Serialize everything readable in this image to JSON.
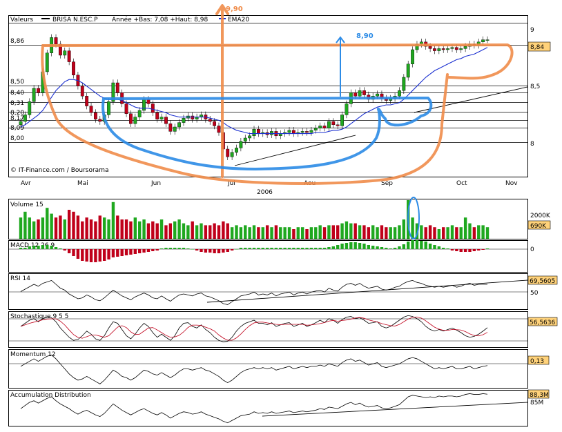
{
  "header": {
    "valeurs_label": "Valeurs",
    "ticker": "BRISA N.ESC.P",
    "range_text": "Année +Bas: 7,08 +Haut: 8,98",
    "ema_label": "EMA20",
    "source": "© IT-Finance.com / Boursorama",
    "year": "2006"
  },
  "annotations": {
    "orange_target": "9,90",
    "blue_target": "8,90"
  },
  "colors": {
    "up": "#1fa81f",
    "down": "#c0001a",
    "ema": "#1a2fd0",
    "orange": "#f08c4a",
    "blue": "#2c8be6",
    "value_box": "#ffd27a",
    "grid": "#000000"
  },
  "chart_data": [
    {
      "name": "price",
      "type": "candlestick",
      "x_months": [
        "Avr",
        "Mai",
        "Jun",
        "Jul",
        "Aou",
        "Sep",
        "Oct",
        "Nov"
      ],
      "y_ticks_right": [
        "9",
        "8,5",
        "8"
      ],
      "y_ticks_left": [
        "8,86",
        "8,50",
        "8,40",
        "8,31",
        "8,20",
        "8,17",
        "8,09",
        "8,00"
      ],
      "ylim": [
        7.6,
        9.05
      ],
      "last_value": "8,84",
      "close": [
        8.1,
        8.16,
        8.28,
        8.4,
        8.36,
        8.55,
        8.72,
        8.86,
        8.8,
        8.7,
        8.74,
        8.64,
        8.52,
        8.42,
        8.33,
        8.24,
        8.18,
        8.12,
        8.1,
        8.16,
        8.28,
        8.45,
        8.36,
        8.26,
        8.17,
        8.08,
        8.14,
        8.2,
        8.3,
        8.26,
        8.18,
        8.12,
        8.14,
        8.08,
        8.01,
        8.05,
        8.09,
        8.13,
        8.15,
        8.12,
        8.14,
        8.16,
        8.12,
        8.1,
        8.06,
        8.0,
        7.85,
        7.78,
        7.82,
        7.86,
        7.92,
        7.95,
        7.97,
        8.03,
        7.99,
        8.0,
        7.98,
        8.01,
        7.97,
        7.99,
        8.0,
        8.02,
        7.99,
        8.0,
        8.01,
        8.0,
        8.02,
        8.04,
        8.06,
        8.04,
        8.1,
        8.07,
        8.06,
        8.16,
        8.26,
        8.36,
        8.33,
        8.38,
        8.34,
        8.3,
        8.33,
        8.35,
        8.31,
        8.29,
        8.31,
        8.33,
        8.38,
        8.5,
        8.62,
        8.75,
        8.8,
        8.82,
        8.78,
        8.76,
        8.74,
        8.76,
        8.75,
        8.76,
        8.77,
        8.75,
        8.76,
        8.78,
        8.8,
        8.79,
        8.82,
        8.84,
        8.84
      ],
      "ema20": [
        8.05,
        8.07,
        8.1,
        8.13,
        8.16,
        8.2,
        8.26,
        8.32,
        8.38,
        8.42,
        8.46,
        8.48,
        8.48,
        8.47,
        8.45,
        8.42,
        8.39,
        8.36,
        8.33,
        8.31,
        8.3,
        8.3,
        8.3,
        8.29,
        8.27,
        8.25,
        8.23,
        8.22,
        8.22,
        8.22,
        8.21,
        8.2,
        8.19,
        8.18,
        8.16,
        8.15,
        8.14,
        8.14,
        8.14,
        8.14,
        8.14,
        8.14,
        8.14,
        8.13,
        8.12,
        8.11,
        8.09,
        8.06,
        8.04,
        8.02,
        8.01,
        8.0,
        7.99,
        7.99,
        7.99,
        7.99,
        7.99,
        7.99,
        7.99,
        7.99,
        7.99,
        7.99,
        7.99,
        7.99,
        7.99,
        7.99,
        7.99,
        8.0,
        8.0,
        8.0,
        8.01,
        8.02,
        8.02,
        8.03,
        8.05,
        8.08,
        8.11,
        8.14,
        8.17,
        8.19,
        8.21,
        8.23,
        8.24,
        8.25,
        8.25,
        8.26,
        8.27,
        8.3,
        8.34,
        8.38,
        8.42,
        8.46,
        8.5,
        8.53,
        8.56,
        8.58,
        8.6,
        8.62,
        8.64,
        8.66,
        8.67,
        8.69,
        8.7,
        8.71,
        8.73,
        8.75,
        8.77
      ]
    },
    {
      "name": "volume",
      "type": "bar",
      "label": "Volume 15",
      "y_ticks": [
        "2000K"
      ],
      "last_value": "690K",
      "values": [
        0.55,
        0.7,
        0.55,
        0.45,
        0.5,
        0.55,
        0.8,
        0.65,
        0.55,
        0.6,
        0.5,
        0.75,
        0.7,
        0.6,
        0.45,
        0.55,
        0.5,
        0.45,
        0.6,
        0.55,
        0.5,
        0.95,
        0.6,
        0.5,
        0.5,
        0.45,
        0.55,
        0.45,
        0.5,
        0.4,
        0.45,
        0.4,
        0.5,
        0.35,
        0.4,
        0.45,
        0.5,
        0.4,
        0.35,
        0.45,
        0.35,
        0.4,
        0.35,
        0.35,
        0.4,
        0.35,
        0.45,
        0.4,
        0.3,
        0.35,
        0.3,
        0.35,
        0.3,
        0.35,
        0.3,
        0.3,
        0.35,
        0.3,
        0.35,
        0.3,
        0.3,
        0.3,
        0.25,
        0.3,
        0.3,
        0.25,
        0.3,
        0.3,
        0.35,
        0.3,
        0.35,
        0.35,
        0.35,
        0.4,
        0.45,
        0.4,
        0.4,
        0.35,
        0.35,
        0.3,
        0.35,
        0.3,
        0.35,
        0.3,
        0.3,
        0.3,
        0.35,
        0.5,
        1.0,
        0.55,
        0.4,
        0.35,
        0.3,
        0.35,
        0.3,
        0.25,
        0.3,
        0.3,
        0.35,
        0.3,
        0.3,
        0.55,
        0.4,
        0.3,
        0.35,
        0.35,
        0.3
      ]
    },
    {
      "name": "macd",
      "type": "bar",
      "label": "MACD 12 26 9",
      "y_ticks": [
        "0"
      ],
      "values": [
        0.1,
        0.1,
        0.2,
        0.25,
        0.25,
        0.3,
        0.3,
        0.25,
        0.15,
        0.05,
        -0.1,
        -0.3,
        -0.5,
        -0.7,
        -0.85,
        -0.9,
        -0.95,
        -0.95,
        -0.9,
        -0.85,
        -0.75,
        -0.6,
        -0.55,
        -0.5,
        -0.45,
        -0.4,
        -0.35,
        -0.3,
        -0.25,
        -0.2,
        -0.15,
        -0.1,
        0.05,
        0.1,
        0.1,
        0.1,
        0.1,
        0.1,
        0.05,
        0.0,
        -0.1,
        -0.2,
        -0.25,
        -0.25,
        -0.3,
        -0.3,
        -0.25,
        -0.2,
        -0.1,
        0.0,
        0.1,
        0.1,
        0.1,
        0.1,
        0.1,
        0.1,
        0.1,
        0.1,
        0.1,
        0.1,
        0.1,
        0.1,
        0.1,
        0.1,
        0.1,
        0.1,
        0.1,
        0.1,
        0.1,
        0.1,
        0.15,
        0.2,
        0.3,
        0.4,
        0.45,
        0.5,
        0.5,
        0.45,
        0.4,
        0.3,
        0.25,
        0.2,
        0.15,
        0.1,
        0.05,
        0.1,
        0.2,
        0.35,
        0.55,
        0.65,
        0.65,
        0.6,
        0.55,
        0.4,
        0.3,
        0.2,
        0.1,
        0.05,
        -0.1,
        -0.15,
        -0.2,
        -0.2,
        -0.2,
        -0.15,
        -0.1,
        -0.05,
        0.05
      ]
    },
    {
      "name": "rsi",
      "type": "line",
      "label": "RSI 14",
      "y_ticks": [
        "50"
      ],
      "last_value": "69,5605",
      "ylim": [
        0,
        100
      ],
      "values": [
        55,
        60,
        65,
        70,
        66,
        72,
        75,
        78,
        70,
        62,
        58,
        50,
        45,
        40,
        42,
        48,
        44,
        38,
        36,
        42,
        50,
        58,
        52,
        46,
        42,
        38,
        44,
        48,
        52,
        48,
        42,
        40,
        46,
        40,
        35,
        42,
        48,
        50,
        48,
        46,
        50,
        52,
        46,
        44,
        40,
        36,
        30,
        28,
        34,
        40,
        46,
        48,
        50,
        54,
        48,
        50,
        48,
        52,
        46,
        50,
        52,
        54,
        48,
        52,
        54,
        50,
        54,
        56,
        58,
        54,
        62,
        58,
        56,
        64,
        70,
        72,
        68,
        72,
        66,
        62,
        64,
        66,
        60,
        58,
        60,
        64,
        66,
        72,
        76,
        78,
        74,
        72,
        68,
        66,
        64,
        66,
        64,
        66,
        68,
        64,
        66,
        70,
        72,
        68,
        70,
        70,
        70
      ]
    },
    {
      "name": "stochastic",
      "type": "line",
      "label": "Stochastique 9 5 5",
      "last_value": "56,5636",
      "ylim": [
        0,
        100
      ],
      "values": [
        60,
        70,
        80,
        85,
        75,
        85,
        90,
        88,
        75,
        55,
        40,
        25,
        15,
        18,
        30,
        45,
        35,
        20,
        15,
        30,
        55,
        75,
        70,
        50,
        30,
        20,
        35,
        55,
        70,
        60,
        40,
        25,
        35,
        25,
        15,
        30,
        55,
        70,
        72,
        60,
        55,
        65,
        50,
        40,
        25,
        15,
        10,
        12,
        25,
        45,
        60,
        70,
        75,
        80,
        70,
        70,
        65,
        72,
        60,
        65,
        70,
        72,
        60,
        65,
        70,
        60,
        65,
        72,
        80,
        72,
        85,
        80,
        70,
        82,
        90,
        92,
        85,
        88,
        80,
        70,
        72,
        75,
        60,
        55,
        60,
        70,
        80,
        90,
        95,
        92,
        85,
        75,
        60,
        50,
        45,
        50,
        45,
        50,
        55,
        48,
        40,
        30,
        25,
        28,
        35,
        45,
        56
      ]
    },
    {
      "name": "momentum",
      "type": "line",
      "label": "Momentum 12",
      "last_value": "0,13",
      "values": [
        0.1,
        0.2,
        0.3,
        0.4,
        0.3,
        0.4,
        0.5,
        0.55,
        0.4,
        0.2,
        0.0,
        -0.2,
        -0.35,
        -0.45,
        -0.4,
        -0.3,
        -0.4,
        -0.5,
        -0.6,
        -0.45,
        -0.25,
        -0.05,
        -0.15,
        -0.3,
        -0.35,
        -0.45,
        -0.35,
        -0.2,
        -0.05,
        -0.1,
        -0.2,
        -0.25,
        -0.15,
        -0.25,
        -0.35,
        -0.25,
        -0.1,
        0.0,
        0.0,
        -0.05,
        0.0,
        0.05,
        -0.05,
        -0.1,
        -0.2,
        -0.3,
        -0.45,
        -0.55,
        -0.45,
        -0.3,
        -0.15,
        -0.05,
        0.0,
        0.05,
        0.0,
        0.05,
        0.0,
        0.05,
        -0.05,
        0.0,
        0.05,
        0.1,
        0.0,
        0.05,
        0.1,
        0.05,
        0.1,
        0.1,
        0.15,
        0.1,
        0.2,
        0.15,
        0.1,
        0.25,
        0.35,
        0.4,
        0.3,
        0.35,
        0.25,
        0.15,
        0.2,
        0.25,
        0.1,
        0.05,
        0.1,
        0.15,
        0.2,
        0.3,
        0.4,
        0.45,
        0.4,
        0.3,
        0.2,
        0.1,
        0.0,
        0.05,
        0.0,
        0.05,
        0.1,
        0.0,
        0.0,
        0.05,
        0.1,
        0.0,
        0.05,
        0.1,
        0.13
      ]
    },
    {
      "name": "accumulation",
      "type": "line",
      "label": "Accumulation Distribution",
      "y_ticks": [
        "85M"
      ],
      "last_value": "88,3M",
      "values": [
        70,
        74,
        78,
        80,
        77,
        80,
        83,
        85,
        80,
        76,
        73,
        70,
        66,
        63,
        66,
        68,
        65,
        62,
        60,
        64,
        70,
        76,
        72,
        68,
        65,
        62,
        65,
        68,
        70,
        67,
        64,
        62,
        65,
        62,
        58,
        61,
        64,
        66,
        65,
        63,
        64,
        66,
        63,
        61,
        59,
        57,
        54,
        52,
        55,
        58,
        61,
        62,
        63,
        66,
        64,
        65,
        64,
        66,
        64,
        65,
        66,
        67,
        65,
        66,
        67,
        66,
        67,
        68,
        70,
        69,
        72,
        71,
        70,
        73,
        76,
        78,
        75,
        77,
        74,
        72,
        73,
        74,
        71,
        70,
        71,
        73,
        75,
        80,
        85,
        87,
        86,
        85,
        84,
        85,
        84,
        86,
        85,
        86,
        86,
        85,
        86,
        88,
        89,
        88,
        88,
        89,
        88.3
      ]
    }
  ]
}
